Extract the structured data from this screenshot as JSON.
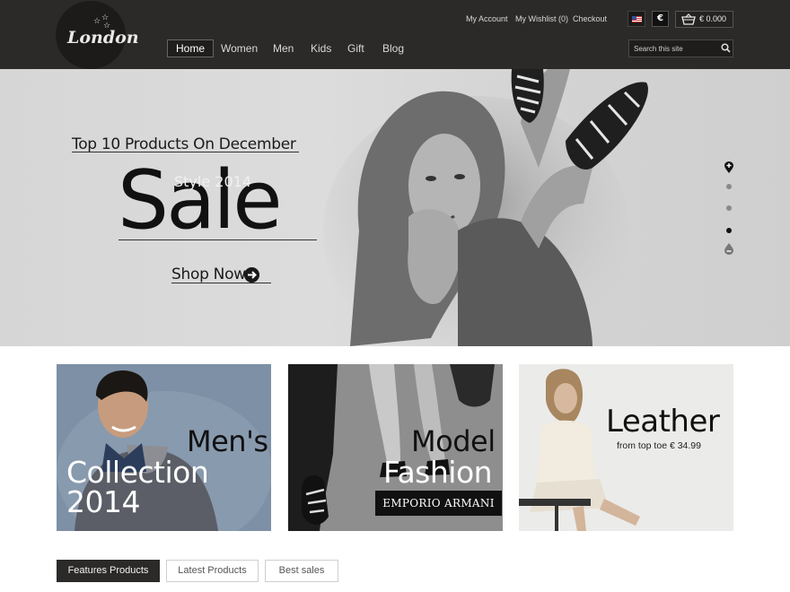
{
  "brand": {
    "logo_text": "London",
    "logo_stars": "☆ ☆ ☆"
  },
  "top_links": {
    "account": "My Account",
    "wishlist": "My Wishlist (0)",
    "checkout": "Checkout"
  },
  "locale": {
    "flag_icon": "us-flag-icon",
    "currency": "€"
  },
  "cart": {
    "icon": "basket-icon",
    "total": "€ 0.000"
  },
  "main_nav": [
    {
      "label": "Home",
      "active": true
    },
    {
      "label": "Women",
      "active": false
    },
    {
      "label": "Men",
      "active": false
    },
    {
      "label": "Kids",
      "active": false
    },
    {
      "label": "Gift",
      "active": false
    },
    {
      "label": "Blog",
      "active": false
    }
  ],
  "search": {
    "placeholder": "Search this site",
    "icon": "search-icon"
  },
  "hero": {
    "top_line": "Top 10 Products On December",
    "overlay": "Style 2014",
    "headline": "Sale",
    "cta": "Shop Now",
    "slides_total": 4,
    "slide_active": 4
  },
  "banners": [
    {
      "line1": "Men's",
      "line2": "Collection 2014"
    },
    {
      "line1": "Model",
      "line2": "Fashion",
      "brand": "EMPORIO ARMANI"
    },
    {
      "title": "Leather",
      "subtitle": "from top toe € 34.99"
    }
  ],
  "product_tabs": [
    {
      "label": "Features Products",
      "active": true
    },
    {
      "label": "Latest Products",
      "active": false
    },
    {
      "label": "Best sales",
      "active": false
    }
  ],
  "colors": {
    "header_bg": "#2b2a29",
    "hero_bg": "#d6d6d6",
    "accent_dark": "#111111"
  }
}
